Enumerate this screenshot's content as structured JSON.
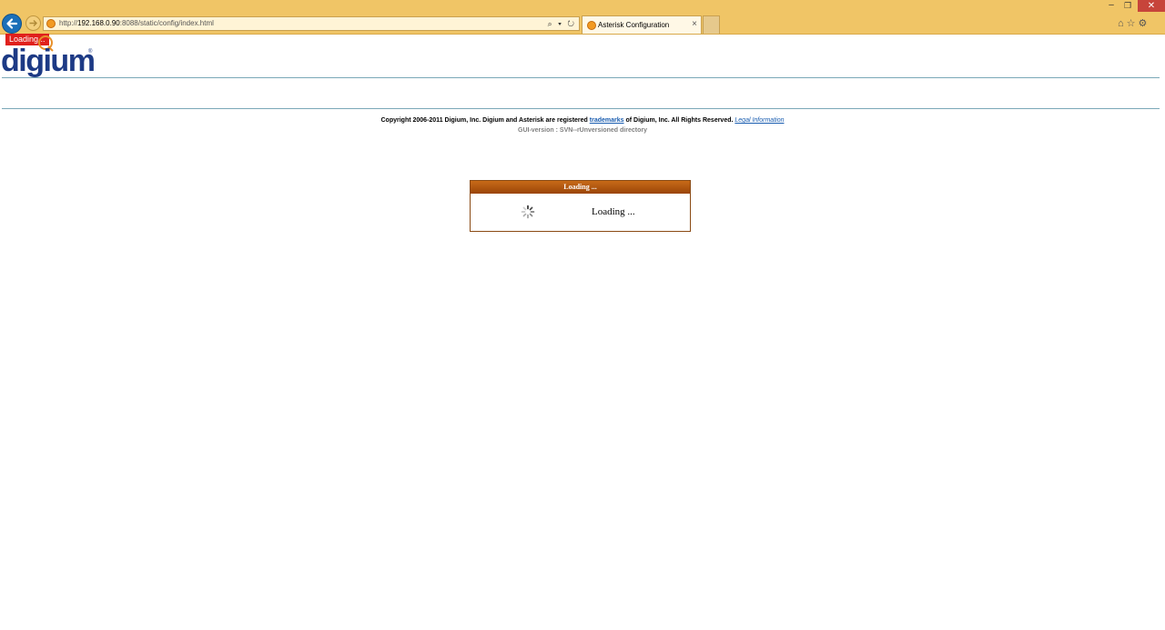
{
  "browser": {
    "url_prefix": "http://",
    "url_host": "192.168.0.90",
    "url_rest": ":8088/static/config/index.html",
    "address_icons": "⌕ ▾ ↻",
    "tab_title": "Asterisk Configuration",
    "tab_close": "×",
    "min_glyph": "‒",
    "restore_glyph": "❐",
    "close_glyph": "✕",
    "right_icons": "⌂☆⚙"
  },
  "page": {
    "loading_badge": "Loading...",
    "logo_text": "digium",
    "logo_reg": "®",
    "copyright_before": "Copyright 2006-2011 Digium, Inc. Digium and Asterisk are registered ",
    "trademarks_link": "trademarks",
    "copyright_after": " of Digium, Inc. All Rights Reserved. ",
    "legal_link": "Legal Information",
    "gui_version": "GUI-version : SVN--rUnversioned directory"
  },
  "dialog": {
    "title": "Loading ...",
    "message": "Loading ..."
  },
  "colors": {
    "chrome": "#f0c566",
    "brand": "#1d3a85",
    "dialog_header": "#b05a10",
    "badge": "#e0201c"
  }
}
